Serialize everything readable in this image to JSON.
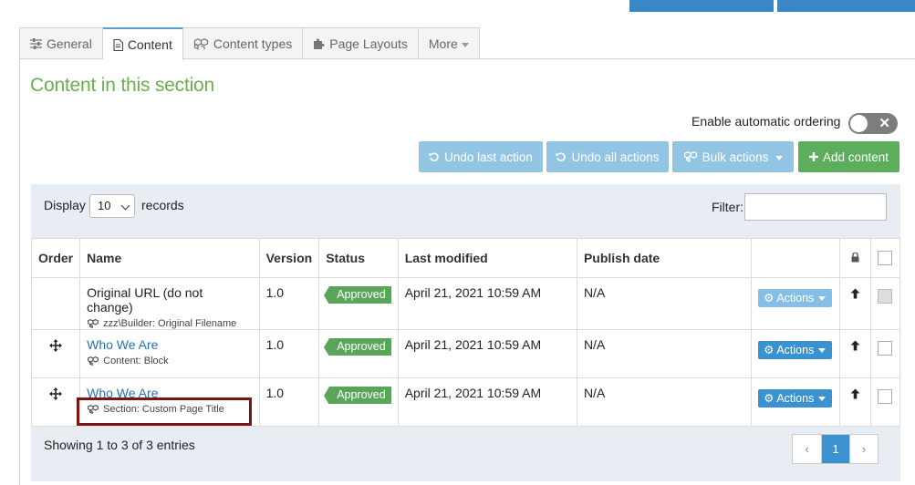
{
  "tabs": [
    {
      "label": "General",
      "icon": "sliders-icon"
    },
    {
      "label": "Content",
      "icon": "document-icon",
      "active": true
    },
    {
      "label": "Content types",
      "icon": "cubes-icon"
    },
    {
      "label": "Page Layouts",
      "icon": "puzzle-icon"
    },
    {
      "label": "More",
      "icon": "caret-down-icon"
    }
  ],
  "section_title": "Content in this section",
  "auto_ordering": {
    "label": "Enable automatic ordering",
    "enabled": false
  },
  "toolbar": {
    "undo_last": "Undo last action",
    "undo_all": "Undo all actions",
    "bulk_actions": "Bulk actions",
    "add_content": "Add content"
  },
  "list_controls": {
    "display_label": "Display",
    "page_size": "10",
    "records_label": "records",
    "filter_label": "Filter:",
    "filter_value": ""
  },
  "table": {
    "headers": {
      "order": "Order",
      "name": "Name",
      "version": "Version",
      "status": "Status",
      "last_modified": "Last modified",
      "publish_date": "Publish date"
    },
    "rows": [
      {
        "name": "Original URL (do not change)",
        "sub": "zzz\\Builder: Original Filename",
        "version": "1.0",
        "status": "Approved",
        "last_modified": "April 21, 2021 10:59 AM",
        "publish_date": "N/A",
        "actions": "Actions"
      },
      {
        "name": "Who We Are",
        "sub": "Content: Block",
        "version": "1.0",
        "status": "Approved",
        "last_modified": "April 21, 2021 10:59 AM",
        "publish_date": "N/A",
        "actions": "Actions"
      },
      {
        "name": "Who We Are",
        "sub": "Section: Custom Page Title",
        "version": "1.0",
        "status": "Approved",
        "last_modified": "April 21, 2021 10:59 AM",
        "publish_date": "N/A",
        "actions": "Actions"
      }
    ]
  },
  "footer": {
    "showing": "Showing 1 to 3 of 3 entries",
    "pager_prev": "‹",
    "pager_current": "1",
    "pager_next": "›"
  },
  "colors": {
    "primary": "#3a93d0",
    "success": "#5aa55a",
    "section_title": "#6ab04c",
    "highlight": "#7a1616"
  }
}
